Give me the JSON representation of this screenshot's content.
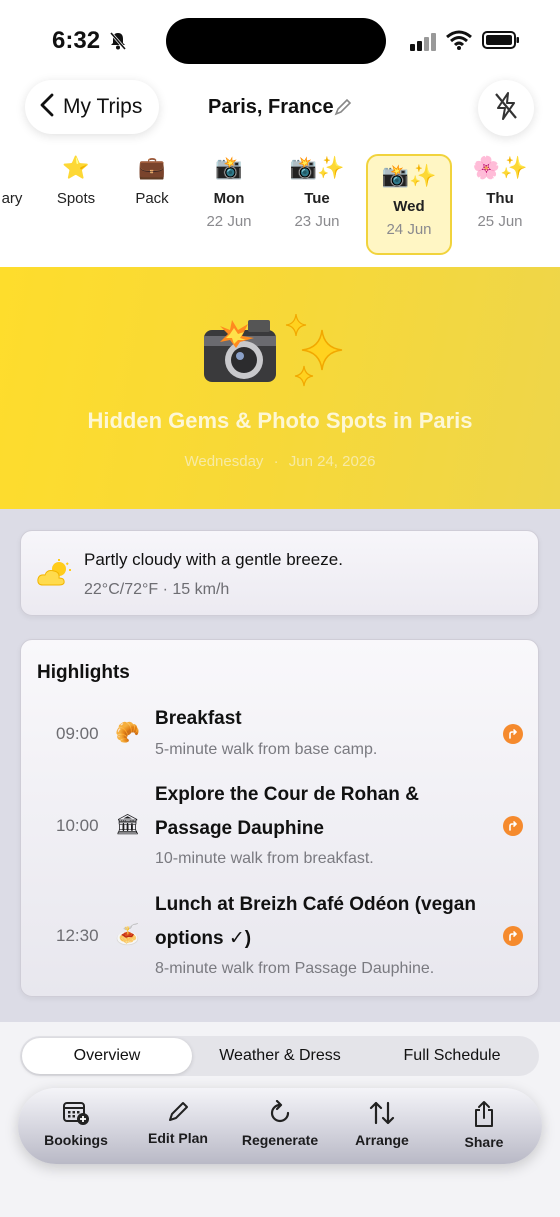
{
  "status_bar": {
    "time": "6:32"
  },
  "nav": {
    "back_label": "My Trips",
    "title": "Paris, France"
  },
  "day_tabs": [
    {
      "emoji": "",
      "label": "ary",
      "date": ""
    },
    {
      "emoji": "⭐",
      "label": "Spots",
      "date": ""
    },
    {
      "emoji": "💼",
      "label": "Pack",
      "date": ""
    },
    {
      "emoji": "📸",
      "label": "Mon",
      "date": "22 Jun"
    },
    {
      "emoji": "📸✨",
      "label": "Tue",
      "date": "23 Jun"
    },
    {
      "emoji": "📸✨",
      "label": "Wed",
      "date": "24 Jun"
    },
    {
      "emoji": "🌸✨",
      "label": "Thu",
      "date": "25 Jun"
    }
  ],
  "hero": {
    "title": "Hidden Gems & Photo Spots in Paris",
    "weekday": "Wednesday",
    "separator": "·",
    "date": "Jun 24, 2026"
  },
  "weather": {
    "description": "Partly cloudy with a gentle breeze.",
    "meta": "22°C/72°F  ·  15 km/h"
  },
  "highlights": {
    "title": "Highlights",
    "items": [
      {
        "time": "09:00",
        "emoji": "🥐",
        "title": "Breakfast",
        "subtitle": "5-minute walk from base camp."
      },
      {
        "time": "10:00",
        "emoji": "🏛",
        "title": "Explore the Cour de Rohan & Passage Dauphine",
        "subtitle": "10-minute walk from breakfast."
      },
      {
        "time": "12:30",
        "emoji": "🍝",
        "title": "Lunch at Breizh Café Odéon (vegan options ✓)",
        "subtitle": "8-minute walk from Passage Dauphine."
      }
    ]
  },
  "segments": {
    "overview": "Overview",
    "weather_dress": "Weather & Dress",
    "full_schedule": "Full Schedule"
  },
  "toolbar": {
    "bookings": "Bookings",
    "edit_plan": "Edit Plan",
    "regenerate": "Regenerate",
    "arrange": "Arrange",
    "share": "Share"
  },
  "colors": {
    "hero_yellow": "#fedd2c",
    "selected_tab": "#fff6c4",
    "accent_orange": "#f58a2d"
  }
}
